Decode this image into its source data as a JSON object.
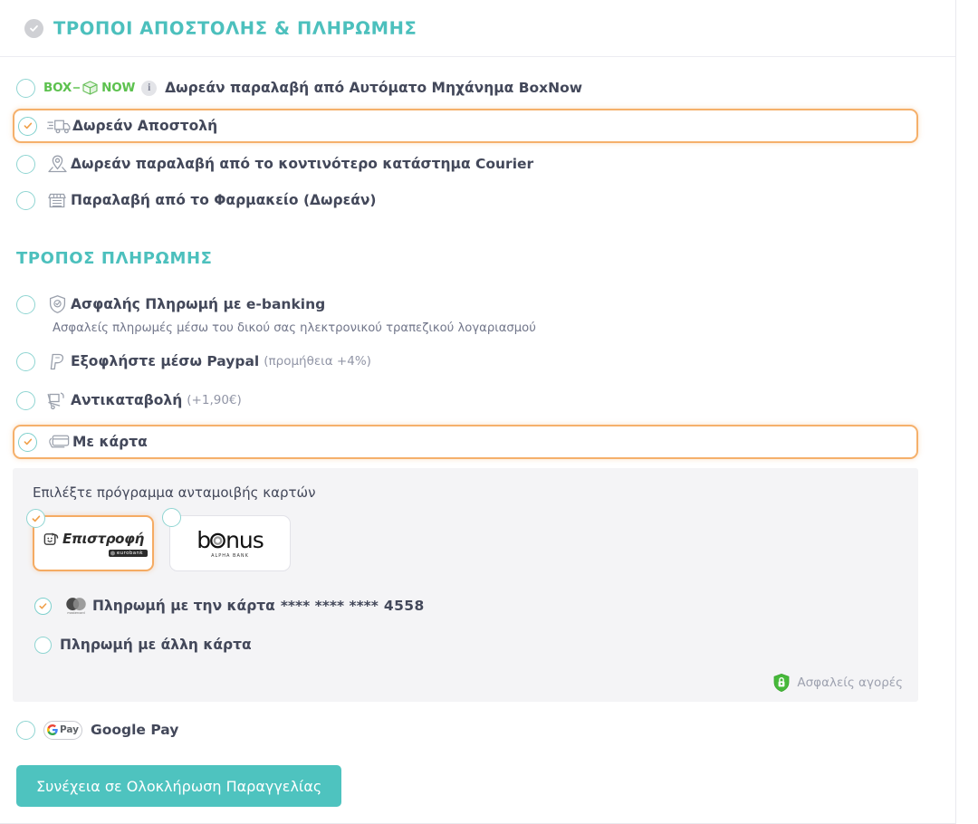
{
  "header": {
    "title": "ΤΡΟΠΟΙ ΑΠΟΣΤΟΛΗΣ & ΠΛΗΡΩΜΗΣ",
    "check_icon": "check-circle-icon"
  },
  "shipping": {
    "options": [
      {
        "id": "boxnow",
        "logo_box": "BOX",
        "logo_now": "NOW",
        "info_icon": "i",
        "label": "Δωρεάν παραλαβή από Αυτόματο Μηχάνημα BoxNow",
        "selected": false,
        "icon": "boxnow-logo-icon"
      },
      {
        "id": "free-shipping",
        "label": "Δωρεάν Αποστολή",
        "selected": true,
        "icon": "delivery-truck-icon"
      },
      {
        "id": "courier-pickup",
        "label": "Δωρεάν παραλαβή από το κοντινότερο κατάστημα Courier",
        "selected": false,
        "icon": "map-pin-icon"
      },
      {
        "id": "pharmacy-pickup",
        "label": "Παραλαβή από το Φαρμακείο (Δωρεάν)",
        "selected": false,
        "icon": "storefront-icon"
      }
    ]
  },
  "payment": {
    "heading": "ΤΡΟΠΟΣ ΠΛΗΡΩΜΗΣ",
    "options": [
      {
        "id": "ebanking",
        "label": "Ασφαλής Πληρωμή με e-banking",
        "note": "",
        "subtext": "Ασφαλείς πληρωμές μέσω του δικού σας ηλεκτρονικού τραπεζικού λογαριασμού",
        "selected": false,
        "icon": "shield-check-icon"
      },
      {
        "id": "paypal",
        "label": "Εξοφλήστε μέσω Paypal",
        "note": "(προμήθεια +4%)",
        "selected": false,
        "icon": "paypal-icon"
      },
      {
        "id": "cod",
        "label": "Αντικαταβολή",
        "note": "(+1,90€)",
        "selected": false,
        "icon": "hand-truck-icon"
      },
      {
        "id": "card",
        "label": "Με κάρτα",
        "note": "",
        "selected": true,
        "icon": "credit-card-icon"
      }
    ],
    "google_pay": {
      "label": "Google Pay",
      "pill_g": "G",
      "pill_pay": "Pay",
      "selected": false,
      "icon": "google-pay-icon"
    }
  },
  "rewards": {
    "title": "Επιλέξτε πρόγραμμα ανταμοιβής καρτών",
    "programs": [
      {
        "id": "epistrofi",
        "name": "Επιστροφή",
        "bank": "eurobank",
        "selected": true,
        "icon": "epistrofi-logo-icon"
      },
      {
        "id": "bonus",
        "name": "bonus",
        "bank": "ALPHA BANK",
        "selected": false,
        "icon": "bonus-logo-icon"
      }
    ],
    "cards": [
      {
        "id": "saved-card",
        "label": "Πληρωμή με την κάρτα",
        "masked": "**** **** ****",
        "last4": "4558",
        "selected": true,
        "icon": "mastercard-icon"
      },
      {
        "id": "other-card",
        "label": "Πληρωμή με άλλη κάρτα",
        "selected": false,
        "icon": ""
      }
    ],
    "secure_label": "Ασφαλείς αγορές",
    "secure_icon": "shield-lock-icon"
  },
  "cta": {
    "label": "Συνέχεια σε Ολοκλήρωση Παραγγελίας"
  },
  "colors": {
    "teal": "#4cc0bd",
    "cta_teal": "#4ec3bf",
    "orange": "#f5ab63",
    "text": "#43485a",
    "muted": "#9195a6",
    "panel": "#f4f4f6",
    "green": "#5cc14e"
  }
}
